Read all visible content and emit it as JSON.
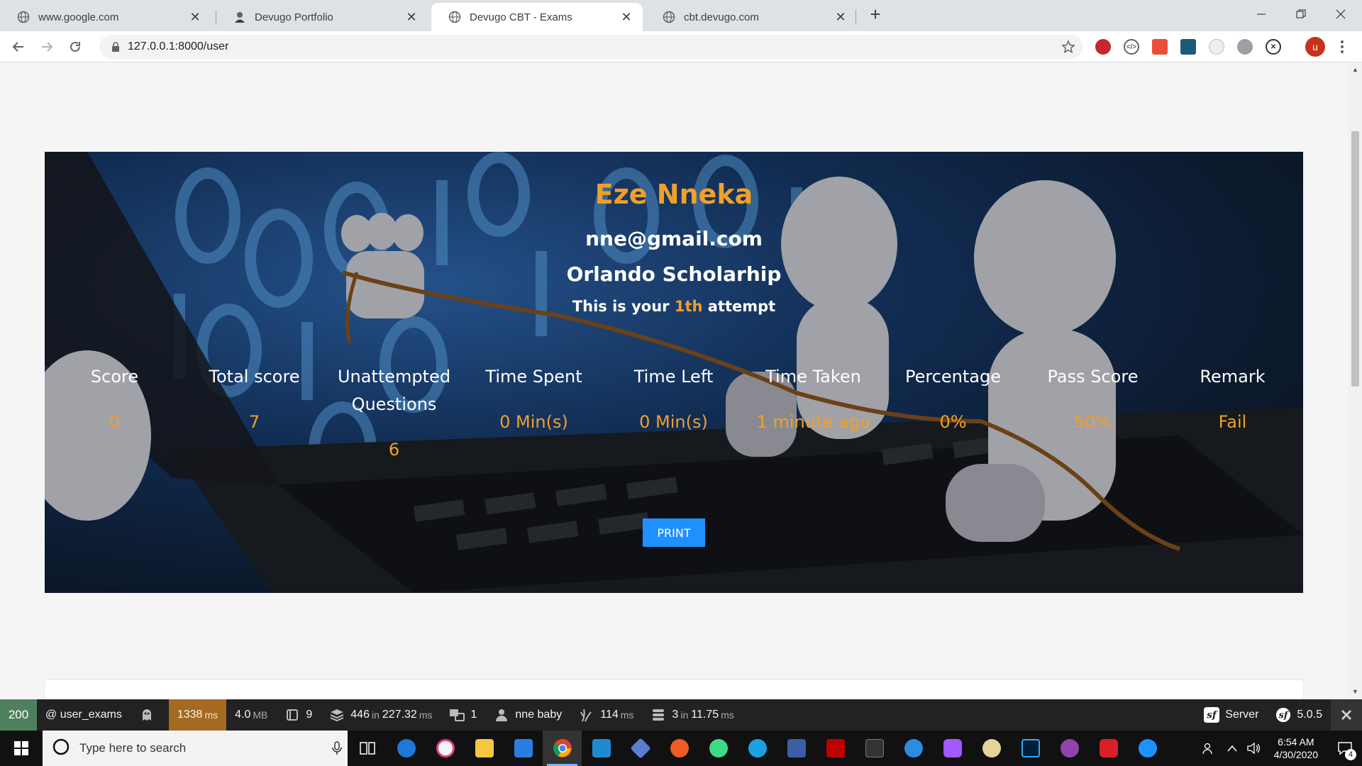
{
  "browser": {
    "tabs": [
      {
        "title": "www.google.com",
        "active": false,
        "icon": "globe-icon"
      },
      {
        "title": "Devugo Portfolio",
        "active": false,
        "icon": "portrait-icon"
      },
      {
        "title": "Devugo CBT - Exams",
        "active": true,
        "icon": "globe-icon"
      },
      {
        "title": "cbt.devugo.com",
        "active": false,
        "icon": "globe-icon"
      }
    ],
    "url": "127.0.0.1:8000/user",
    "profile_initial": "u"
  },
  "result": {
    "name": "Eze Nneka",
    "email": "nne@gmail.com",
    "exam": "Orlando Scholarhip",
    "attempt_prefix": "This is your",
    "attempt_number": "1th",
    "attempt_suffix": "attempt",
    "stats": [
      {
        "label": "Score",
        "value": "0"
      },
      {
        "label": "Total score",
        "value": "7"
      },
      {
        "label": "Unattempted Questions",
        "value": "6"
      },
      {
        "label": "Time Spent",
        "value": "0 Min(s)"
      },
      {
        "label": "Time Left",
        "value": "0 Min(s)"
      },
      {
        "label": "Time Taken",
        "value": "1 minute ago"
      },
      {
        "label": "Percentage",
        "value": "0%"
      },
      {
        "label": "Pass Score",
        "value": "50%"
      },
      {
        "label": "Remark",
        "value": "Fail"
      }
    ],
    "print_label": "PRINT"
  },
  "debug_toolbar": {
    "status": "200",
    "route": "@ user_exams",
    "time": "1338",
    "time_unit": "ms",
    "memory": "4.0",
    "memory_unit": "MB",
    "forms": "9",
    "doctrine_queries": "446",
    "doctrine_in": "in",
    "doctrine_time": "227.32",
    "doctrine_unit": "ms",
    "translations": "1",
    "user": "nne baby",
    "twig_time": "114",
    "twig_unit": "ms",
    "cache_calls": "3",
    "cache_in": "in",
    "cache_time": "11.75",
    "cache_unit": "ms",
    "server_label": "Server",
    "symfony_version": "5.0.5"
  },
  "taskbar": {
    "search_placeholder": "Type here to search",
    "time": "6:54 AM",
    "date": "4/30/2020",
    "notification_count": "4"
  },
  "colors": {
    "accent_orange": "#f0a02a",
    "print_blue": "#1e90ff",
    "status_green": "#4f805d",
    "time_orange": "#a46a1f"
  }
}
